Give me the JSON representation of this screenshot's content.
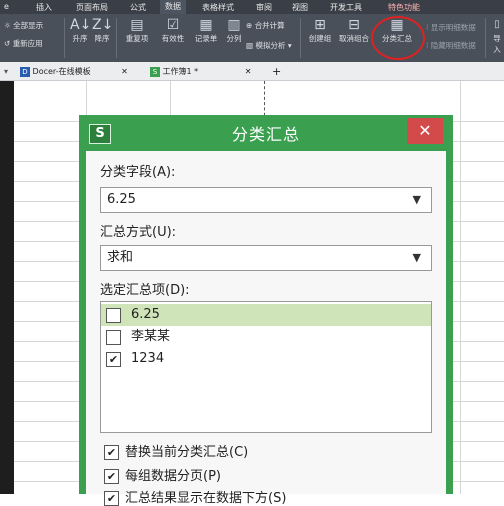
{
  "menubar": {
    "items": [
      "插入",
      "页面布局",
      "公式",
      "数据",
      "表格样式",
      "审阅",
      "视图",
      "开发工具",
      "特色功能"
    ]
  },
  "ribbon": {
    "left_items": [
      "全部显示",
      "重新应用"
    ],
    "sort_asc": "升序",
    "sort_desc": "降序",
    "duplicates": "重复项",
    "validity": "有效性",
    "record": "记录单",
    "split": "分列",
    "merge_calc": "合并计算",
    "simulate": "模拟分析",
    "create_group": "创建组",
    "ungroup": "取消组合",
    "subtotal": "分类汇总",
    "show_detail": "显示明细数据",
    "hide_detail": "隐藏明细数据",
    "import": "导入"
  },
  "tabs": {
    "tab1": "Docer-在线模板",
    "tab2": "工作簿1 *",
    "add": "+"
  },
  "dialog": {
    "logo": "S",
    "title": "分类汇总",
    "close": "✕",
    "group_field_label": "分类字段(A):",
    "group_field_value": "6.25",
    "method_label": "汇总方式(U):",
    "method_value": "求和",
    "items_label": "选定汇总项(D):",
    "items": [
      {
        "label": "6.25",
        "checked": false
      },
      {
        "label": "李某某",
        "checked": false
      },
      {
        "label": "1234",
        "checked": true
      }
    ],
    "options": [
      {
        "label": "替换当前分类汇总(C)",
        "checked": true
      },
      {
        "label": "每组数据分页(P)",
        "checked": true
      },
      {
        "label": "汇总结果显示在数据下方(S)",
        "checked": true
      }
    ]
  }
}
